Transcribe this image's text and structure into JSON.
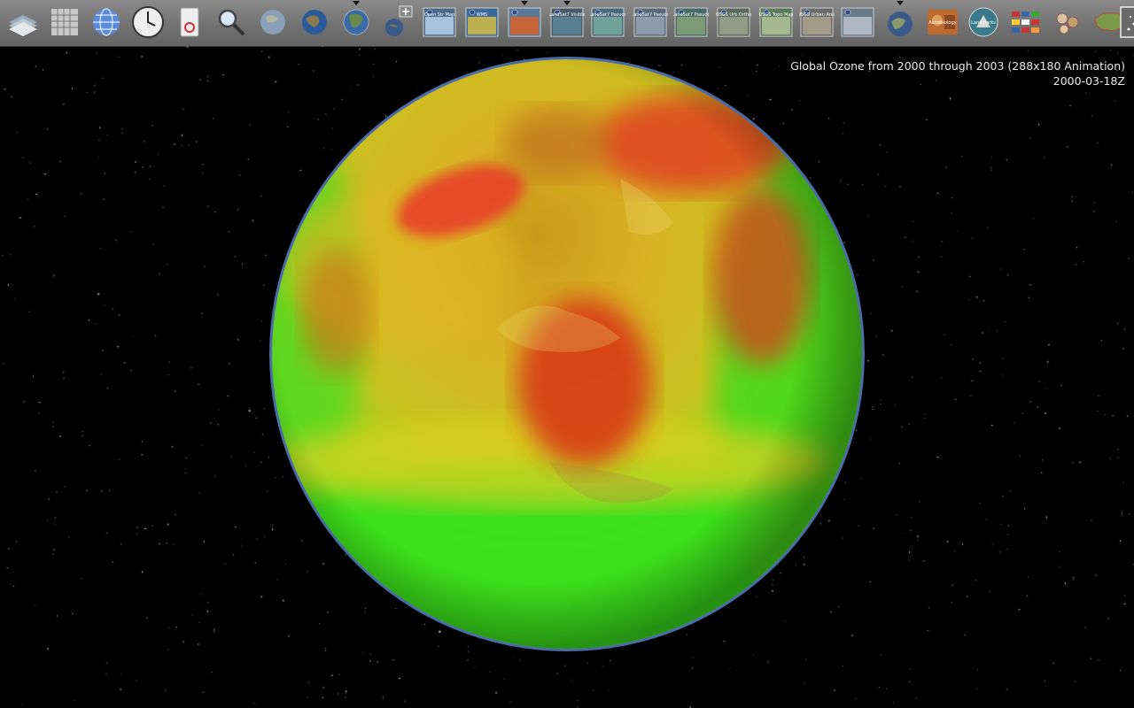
{
  "toolbar": {
    "buttons": [
      {
        "id": "layers",
        "label": ""
      },
      {
        "id": "lat-lon-grid",
        "label": ""
      },
      {
        "id": "place-names",
        "label": ""
      },
      {
        "id": "time",
        "label": ""
      },
      {
        "id": "scalebar",
        "label": ""
      },
      {
        "id": "search",
        "label": ""
      },
      {
        "id": "blue-marble",
        "label": ""
      },
      {
        "id": "globe-2",
        "label": ""
      },
      {
        "id": "globe-3",
        "label": ""
      },
      {
        "id": "add-layer",
        "label": ""
      },
      {
        "id": "open-street-map",
        "label": "Open Str Map"
      },
      {
        "id": "wms",
        "label": "WMS"
      },
      {
        "id": "ozone-anim",
        "label": ""
      },
      {
        "id": "landsat-visible",
        "label": "LandSat7 Visible"
      },
      {
        "id": "landsat-pseudo",
        "label": "LandSat7 Pseudo"
      },
      {
        "id": "landsat-pseudo-2",
        "label": "LandSat7 Pseudo"
      },
      {
        "id": "landsat-pseudo-3",
        "label": "LandSat7 Pseudo"
      },
      {
        "id": "usgs-urban-ortho",
        "label": "USGS Urb Ortho"
      },
      {
        "id": "usgs-topo-map",
        "label": "USGS Topo Map"
      },
      {
        "id": "usgs-urban-area",
        "label": "USGS Urban Area"
      },
      {
        "id": "map-photo",
        "label": ""
      },
      {
        "id": "globe-4",
        "label": ""
      },
      {
        "id": "astrobiology",
        "label": "Astrobiology"
      },
      {
        "id": "landmarks",
        "label": "Landmarks"
      },
      {
        "id": "flags",
        "label": ""
      },
      {
        "id": "sci-map",
        "label": ""
      },
      {
        "id": "us-map",
        "label": ""
      },
      {
        "id": "stars-toggle",
        "label": ""
      }
    ]
  },
  "overlay": {
    "title": "Global Ozone from 2000 through 2003 (288x180 Animation)",
    "date": "2000-03-18Z"
  }
}
